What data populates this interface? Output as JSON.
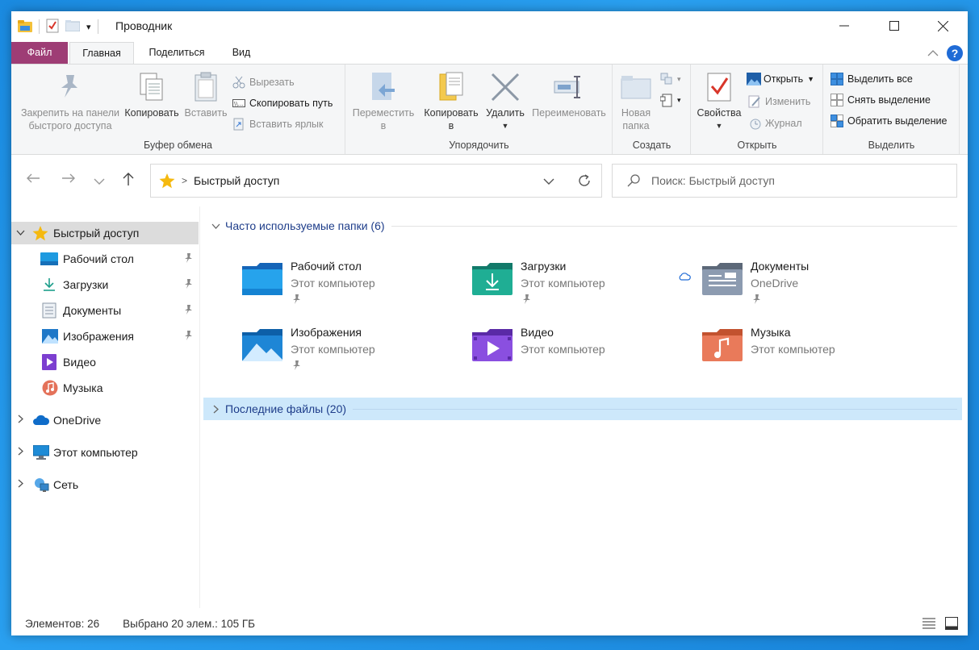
{
  "window": {
    "title": "Проводник",
    "qat_dropdown": "▾"
  },
  "tabs": {
    "file": "Файл",
    "home": "Главная",
    "share": "Поделиться",
    "view": "Вид",
    "help": "?"
  },
  "ribbon": {
    "clipboard": {
      "label": "Буфер обмена",
      "pin_line1": "Закрепить на панели",
      "pin_line2": "быстрого доступа",
      "copy": "Копировать",
      "paste": "Вставить",
      "cut": "Вырезать",
      "copy_path": "Скопировать путь",
      "paste_shortcut": "Вставить ярлык"
    },
    "organize": {
      "label": "Упорядочить",
      "move_line1": "Переместить",
      "move_line2": "в",
      "copyto_line1": "Копировать",
      "copyto_line2": "в",
      "delete": "Удалить",
      "rename": "Переименовать"
    },
    "create": {
      "label": "Создать",
      "new_folder_line1": "Новая",
      "new_folder_line2": "папка"
    },
    "open": {
      "label": "Открыть",
      "properties": "Свойства",
      "open": "Открыть",
      "edit": "Изменить",
      "history": "Журнал"
    },
    "select": {
      "label": "Выделить",
      "select_all": "Выделить все",
      "select_none": "Снять выделение",
      "invert": "Обратить выделение"
    }
  },
  "address": {
    "path": "Быстрый доступ",
    "separator": ">",
    "search_placeholder": "Поиск: Быстрый доступ"
  },
  "navpane": {
    "quick_access": "Быстрый доступ",
    "items": [
      {
        "label": "Рабочий стол",
        "pinned": true
      },
      {
        "label": "Загрузки",
        "pinned": true
      },
      {
        "label": "Документы",
        "pinned": true
      },
      {
        "label": "Изображения",
        "pinned": true
      },
      {
        "label": "Видео",
        "pinned": false
      },
      {
        "label": "Музыка",
        "pinned": false
      }
    ],
    "onedrive": "OneDrive",
    "this_pc": "Этот компьютер",
    "network": "Сеть"
  },
  "content": {
    "frequent_header": "Часто используемые папки (6)",
    "recent_header": "Последние файлы (20)",
    "folders": [
      {
        "name": "Рабочий стол",
        "location": "Этот компьютер",
        "pinned": true
      },
      {
        "name": "Загрузки",
        "location": "Этот компьютер",
        "pinned": true
      },
      {
        "name": "Документы",
        "location": "OneDrive",
        "pinned": true
      },
      {
        "name": "Изображения",
        "location": "Этот компьютер",
        "pinned": true
      },
      {
        "name": "Видео",
        "location": "Этот компьютер",
        "pinned": false
      },
      {
        "name": "Музыка",
        "location": "Этот компьютер",
        "pinned": false
      }
    ]
  },
  "status": {
    "items": "Элементов: 26",
    "selected": "Выбрано 20 элем.: 105 ГБ"
  },
  "colors": {
    "file_tab": "#9e3d75",
    "accent": "#1f6bd6",
    "selection": "#cde8fb"
  }
}
